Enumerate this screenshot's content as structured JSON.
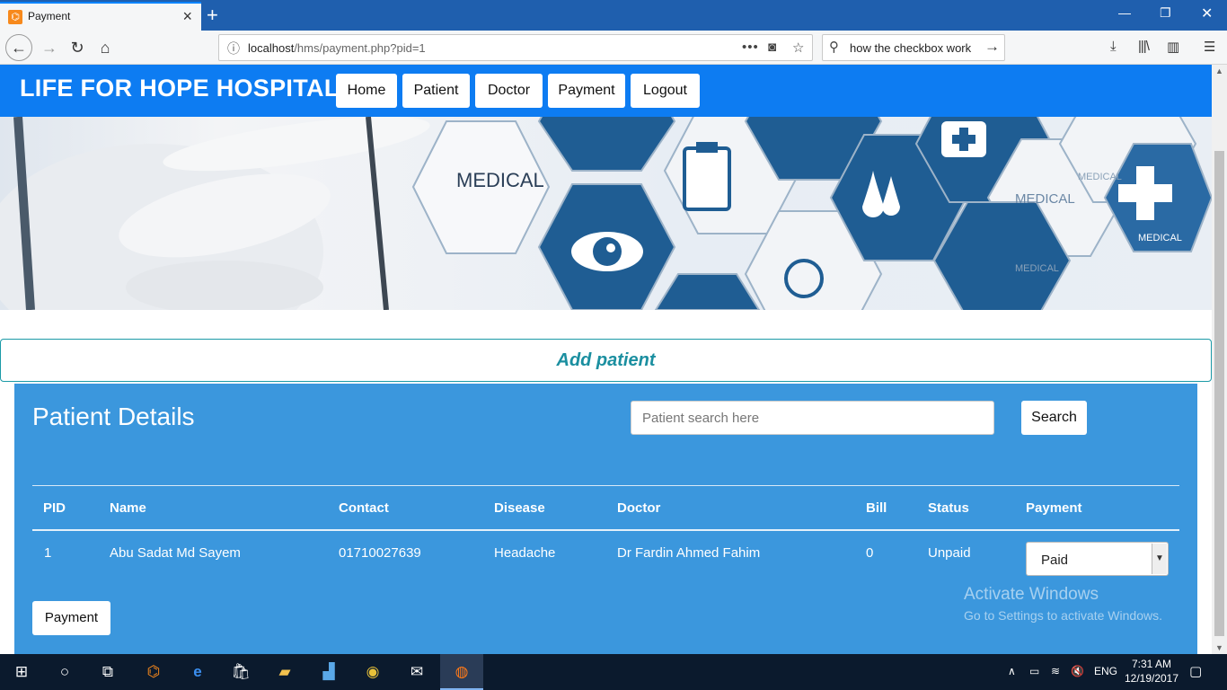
{
  "browser": {
    "tab_title": "Payment",
    "tab_favicon_text": "⌬",
    "url_prefix": "localhost",
    "url_path": "/hms/payment.php?pid=1",
    "search_text": "how the checkbox work"
  },
  "site": {
    "brand": "LIFE FOR HOPE HOSPITAL",
    "nav": [
      "Home",
      "Patient",
      "Doctor",
      "Payment",
      "Logout"
    ]
  },
  "banner": {
    "labels": [
      "MEDICAL",
      "MEDICAL",
      "MEDICAL",
      "MEDICAL",
      "MEDICAL"
    ]
  },
  "add_patient_label": "Add patient",
  "panel": {
    "title": "Patient Details",
    "search_placeholder": "Patient search here",
    "search_button": "Search",
    "columns": [
      "PID",
      "Name",
      "Contact",
      "Disease",
      "Doctor",
      "Bill",
      "Status",
      "Payment"
    ],
    "rows": [
      {
        "pid": "1",
        "name": "Abu Sadat Md Sayem",
        "contact": "01710027639",
        "disease": "Headache",
        "doctor": "Dr Fardin Ahmed Fahim",
        "bill": "0",
        "status": "Unpaid",
        "payment_selected": "Paid"
      }
    ],
    "payment_button": "Payment"
  },
  "watermark": {
    "title": "Activate Windows",
    "subtitle": "Go to Settings to activate Windows."
  },
  "taskbar": {
    "lang": "ENG",
    "time": "7:31 AM",
    "date": "12/19/2017"
  },
  "colors": {
    "site_header": "#0d7cf2",
    "panel": "#3b97dd",
    "add_patient_text": "#1b8fa0",
    "browser_titlebar": "#1f5fae"
  }
}
